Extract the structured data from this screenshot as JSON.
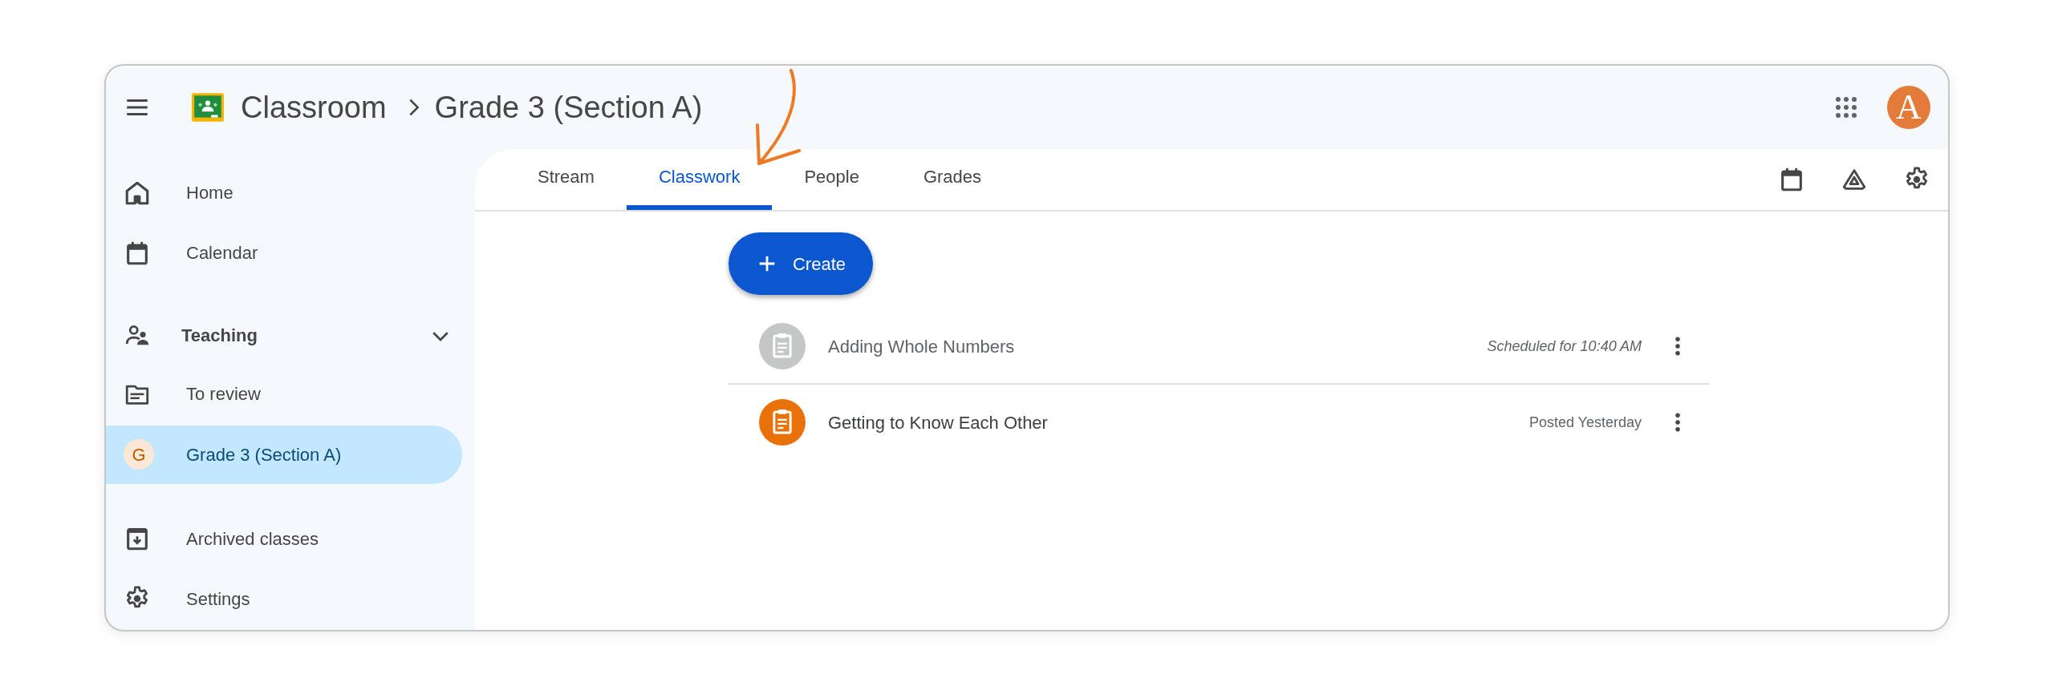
{
  "header": {
    "app_name": "Classroom",
    "breadcrumb": "Grade 3 (Section A)",
    "avatar_letter": "A"
  },
  "sidebar": {
    "items": [
      {
        "kind": "home",
        "label": "Home",
        "selected": false
      },
      {
        "kind": "calendar",
        "label": "Calendar",
        "selected": false
      },
      {
        "kind": "section",
        "label": "Teaching",
        "expanded": true
      },
      {
        "kind": "review",
        "label": "To review",
        "selected": false
      },
      {
        "kind": "class",
        "letter": "G",
        "label": "Grade 3 (Section A)",
        "selected": true
      },
      {
        "kind": "archive",
        "label": "Archived classes",
        "selected": false
      },
      {
        "kind": "settings",
        "label": "Settings",
        "selected": false
      }
    ]
  },
  "tabs": [
    {
      "label": "Stream",
      "selected": false
    },
    {
      "label": "Classwork",
      "selected": true
    },
    {
      "label": "People",
      "selected": false
    },
    {
      "label": "Grades",
      "selected": false
    }
  ],
  "create_button": "Create",
  "assignments": [
    {
      "title": "Adding Whole Numbers",
      "kind": "scheduled",
      "meta": "Scheduled for 10:40 AM"
    },
    {
      "title": "Getting to Know Each Other",
      "kind": "posted",
      "meta": "Posted Yesterday"
    }
  ]
}
